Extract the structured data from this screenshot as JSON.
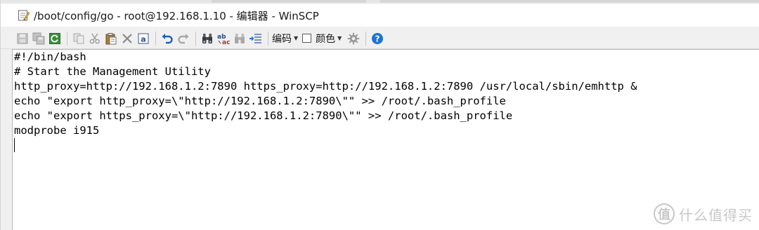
{
  "window": {
    "title": "/boot/config/go - root@192.168.1.10 - 编辑器 - WinSCP"
  },
  "toolbar": {
    "buttons": [
      {
        "icon": "save-icon",
        "enabled": false
      },
      {
        "icon": "save-all-icon",
        "enabled": false
      },
      {
        "icon": "reload-icon",
        "enabled": true
      },
      {
        "icon": "copy-icon",
        "enabled": false
      },
      {
        "icon": "cut-icon",
        "enabled": false
      },
      {
        "icon": "paste-icon",
        "enabled": true
      },
      {
        "icon": "delete-icon",
        "enabled": false
      },
      {
        "icon": "select-all-icon",
        "enabled": true
      },
      {
        "icon": "undo-icon",
        "enabled": true
      },
      {
        "icon": "redo-icon",
        "enabled": false
      },
      {
        "icon": "find-icon",
        "enabled": true
      },
      {
        "icon": "replace-icon",
        "enabled": true
      },
      {
        "icon": "find-next-icon",
        "enabled": false
      },
      {
        "icon": "goto-line-icon",
        "enabled": true
      }
    ],
    "encoding_label": "编码",
    "color_label": "颜色",
    "colors": {
      "accent": "#1e73d2",
      "help": "#1e73d2"
    }
  },
  "editor": {
    "lines": [
      "#!/bin/bash",
      "# Start the Management Utility",
      "http_proxy=http://192.168.1.2:7890 https_proxy=http://192.168.1.2:7890 /usr/local/sbin/emhttp &",
      "echo \"export http_proxy=\\\"http://192.168.1.2:7890\\\"\" >> /root/.bash_profile",
      "echo \"export https_proxy=\\\"http://192.168.1.2:7890\\\"\" >> /root/.bash_profile",
      "modprobe i915"
    ]
  },
  "watermark": {
    "text": "什么值得买",
    "logo": "值"
  }
}
